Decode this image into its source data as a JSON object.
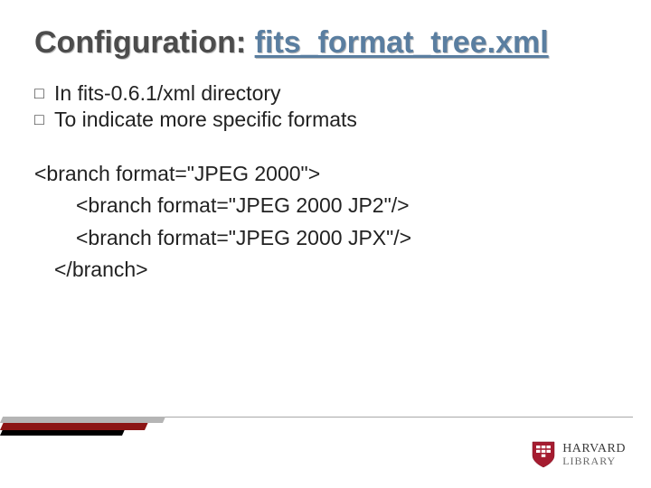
{
  "title": {
    "prefix": "Configuration: ",
    "link": "fits_format_tree.xml"
  },
  "bullets": [
    {
      "box": "□",
      "lead": "In",
      "rest": " fits-0.6.1/xml directory"
    },
    {
      "box": "□",
      "lead": "To",
      "rest": " indicate more specific formats"
    }
  ],
  "code": {
    "line1": "<branch format=\"JPEG 2000\">",
    "line2": "<branch format=\"JPEG 2000 JP2\"/>",
    "line3": "<branch format=\"JPEG 2000 JPX\"/>",
    "line4": "</branch>"
  },
  "logo": {
    "line1": "HARVARD",
    "line2": "LIBRARY"
  }
}
